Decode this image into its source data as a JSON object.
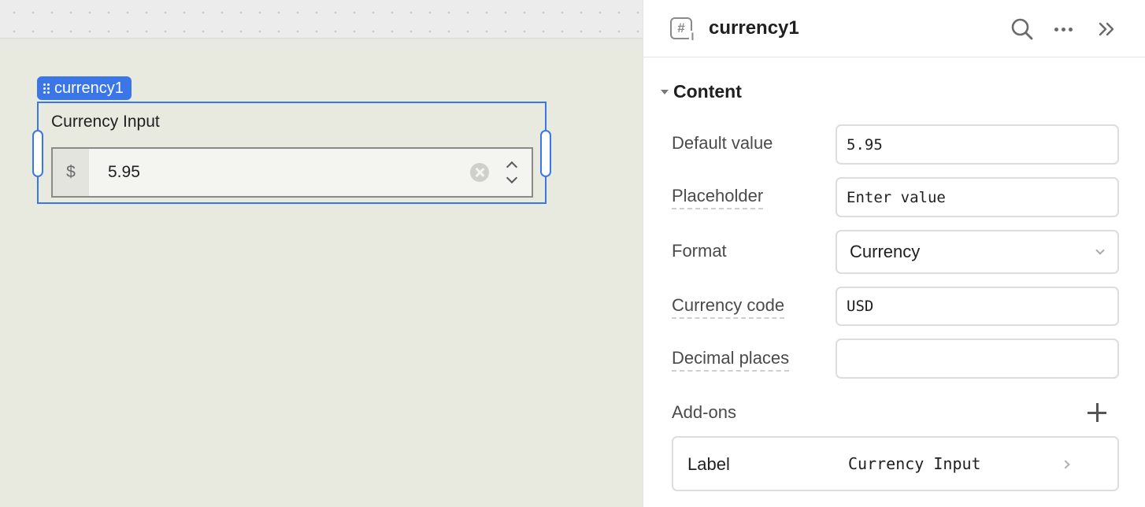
{
  "canvas": {
    "component_tag": "currency1",
    "component": {
      "label": "Currency Input",
      "prefix": "$",
      "value": "5.95"
    }
  },
  "inspector": {
    "title": "currency1",
    "icons": {
      "component": "currency-input-icon",
      "search": "search-icon",
      "more": "more-options-icon",
      "collapse": "collapse-panel-icon"
    },
    "section_title": "Content",
    "fields": {
      "default_value": {
        "label": "Default value",
        "value": "5.95"
      },
      "placeholder": {
        "label": "Placeholder",
        "value": "Enter value"
      },
      "format": {
        "label": "Format",
        "value": "Currency"
      },
      "currency_code": {
        "label": "Currency code",
        "value": "USD"
      },
      "decimal_places": {
        "label": "Decimal places",
        "value": ""
      }
    },
    "addons": {
      "title": "Add-ons",
      "items": [
        {
          "name": "Label",
          "value": "Currency Input"
        }
      ]
    }
  },
  "colors": {
    "accent": "#3b76e8",
    "canvas_bg": "#e8eadf"
  }
}
